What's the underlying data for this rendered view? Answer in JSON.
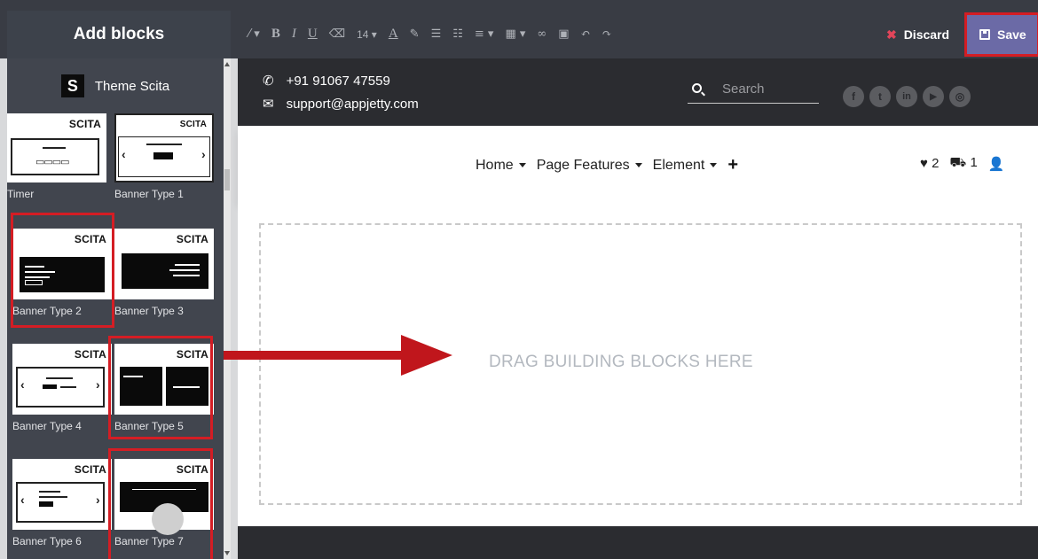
{
  "toolbar": {
    "title": "Add blocks",
    "font_size": "14",
    "discard_label": "Discard",
    "save_label": "Save"
  },
  "sidebar": {
    "theme_logo": "S",
    "theme_name": "Theme Scita",
    "brand": "SCITA",
    "blocks": [
      {
        "label": "Timer"
      },
      {
        "label": "Banner Type 1"
      },
      {
        "label": "Banner Type 2"
      },
      {
        "label": "Banner Type 3"
      },
      {
        "label": "Banner Type 4"
      },
      {
        "label": "Banner Type 5"
      },
      {
        "label": "Banner Type 6"
      },
      {
        "label": "Banner Type 7"
      }
    ]
  },
  "site": {
    "phone": "+91 91067 47559",
    "email": "support@appjetty.com",
    "search_placeholder": "Search",
    "social": [
      "f",
      "t",
      "in",
      "▶",
      "◎"
    ],
    "nav": [
      "Home",
      "Page Features",
      "Element"
    ],
    "wishlist_count": "2",
    "cart_count": "1",
    "drop_text": "DRAG BUILDING BLOCKS HERE"
  },
  "colors": {
    "toolbar_bg": "#393c44",
    "sidebar_bg": "#41454e",
    "save_bg": "#6b6aa6",
    "highlight": "#d41d24",
    "site_dark": "#2b2c30"
  }
}
